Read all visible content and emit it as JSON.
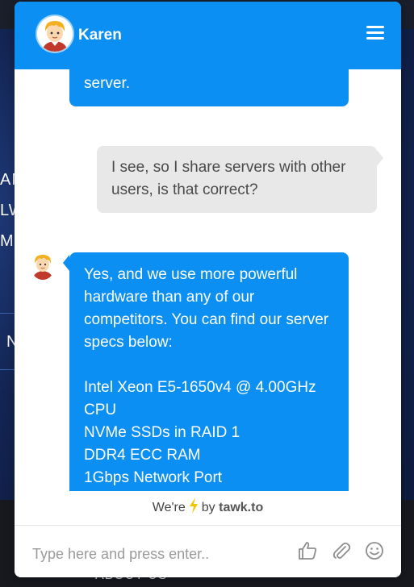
{
  "background_site": {
    "partial_lines": [
      "AN",
      "LW",
      "M",
      "N"
    ],
    "footer_link": "ABOUT US"
  },
  "chat": {
    "agent_name": "Karen",
    "messages": [
      {
        "sender": "agent",
        "text": "server."
      },
      {
        "sender": "visitor",
        "text": "I see, so I share servers with other\nusers, is that correct?"
      },
      {
        "sender": "agent",
        "text": "Yes, and we use more powerful\nhardware than any of our\ncompetitors. You can find our server\nspecs below:\n\nIntel Xeon E5-1650v4 @ 4.00GHz\nCPU\nNVMe SSDs in RAID 1\nDDR4 ECC RAM\n1Gbps Network Port"
      }
    ],
    "branding": {
      "prefix": "We're",
      "by": "by",
      "brand": "tawk.to"
    },
    "composer": {
      "placeholder": "Type here and press enter.."
    },
    "icons": {
      "menu": "hamburger-icon",
      "like": "thumbs-up-icon",
      "attach": "paperclip-icon",
      "emoji": "smiley-icon"
    }
  },
  "colors": {
    "accent": "#0b8ff3",
    "visitor_bubble": "#e8e8e8",
    "bolt": "#f5c400"
  }
}
